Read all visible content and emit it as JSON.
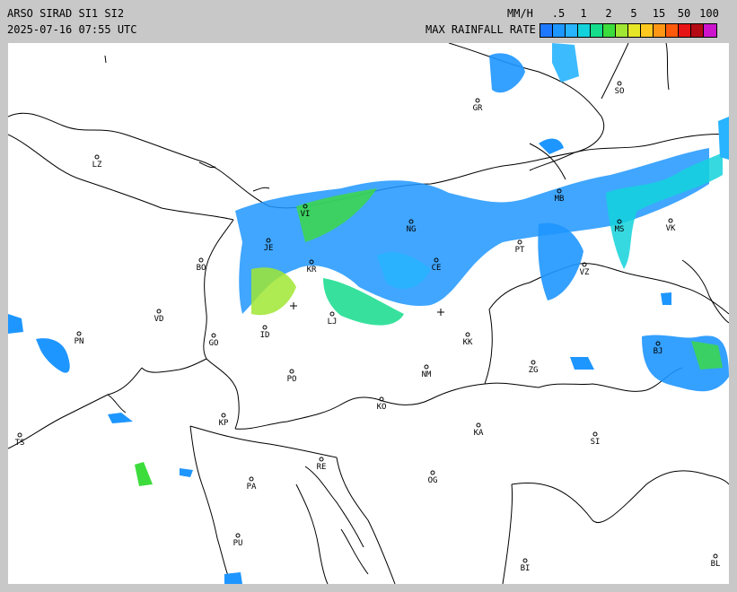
{
  "header": {
    "product": "ARSO SIRAD SI1 SI2",
    "timestamp": "2025-07-16 07:55 UTC",
    "unit": "MM/H",
    "legend_title": "MAX RAINFALL RATE",
    "scale_ticks": [
      ".5",
      "1",
      "2",
      "5",
      "15",
      "50",
      "100"
    ],
    "scale_colors": [
      "#1e78ff",
      "#1e96ff",
      "#28b4ff",
      "#14d2dc",
      "#14dc8c",
      "#3cdc3c",
      "#a0e632",
      "#e6e628",
      "#ffc81e",
      "#ff9614",
      "#ff5a0a",
      "#e61414",
      "#b40a14",
      "#cc14cc"
    ]
  },
  "cities": [
    {
      "code": "SO",
      "name": "city-so"
    },
    {
      "code": "GR",
      "name": "city-gr"
    },
    {
      "code": "LZ",
      "name": "city-lz"
    },
    {
      "code": "JE",
      "name": "city-je"
    },
    {
      "code": "BO",
      "name": "city-bo"
    },
    {
      "code": "VD",
      "name": "city-vd"
    },
    {
      "code": "PN",
      "name": "city-pn"
    },
    {
      "code": "GO",
      "name": "city-go"
    },
    {
      "code": "ID",
      "name": "city-id"
    },
    {
      "code": "KR",
      "name": "city-kr"
    },
    {
      "code": "LJ",
      "name": "city-lj"
    },
    {
      "code": "PO",
      "name": "city-po"
    },
    {
      "code": "NM",
      "name": "city-nm"
    },
    {
      "code": "KK",
      "name": "city-kk"
    },
    {
      "code": "ZG",
      "name": "city-zg"
    },
    {
      "code": "KO",
      "name": "city-ko"
    },
    {
      "code": "KP",
      "name": "city-kp"
    },
    {
      "code": "KA",
      "name": "city-ka"
    },
    {
      "code": "SI",
      "name": "city-si"
    },
    {
      "code": "TS",
      "name": "city-ts"
    },
    {
      "code": "RE",
      "name": "city-re"
    },
    {
      "code": "PA",
      "name": "city-pa"
    },
    {
      "code": "OG",
      "name": "city-og"
    },
    {
      "code": "PU",
      "name": "city-pu"
    },
    {
      "code": "BI",
      "name": "city-bi"
    },
    {
      "code": "BL",
      "name": "city-bl"
    },
    {
      "code": "PT",
      "name": "city-pt"
    },
    {
      "code": "VZ",
      "name": "city-vz"
    },
    {
      "code": "VK",
      "name": "city-vk"
    },
    {
      "code": "BJ",
      "name": "city-bj"
    },
    {
      "code": "MB",
      "name": "city-mb"
    },
    {
      "code": "MS",
      "name": "city-ms"
    },
    {
      "code": "CE",
      "name": "city-ce"
    },
    {
      "code": "NG",
      "name": "city-ng"
    },
    {
      "code": "VI",
      "name": "city-vi"
    }
  ]
}
